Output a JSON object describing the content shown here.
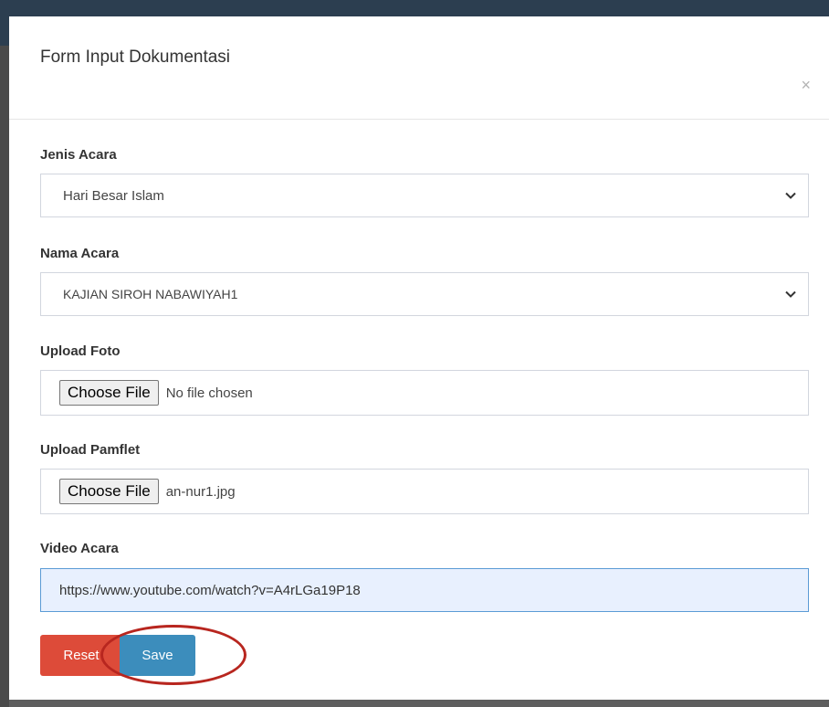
{
  "modal": {
    "title": "Form Input Dokumentasi",
    "close_label": "×"
  },
  "form": {
    "jenis_acara": {
      "label": "Jenis Acara",
      "value": "Hari Besar Islam"
    },
    "nama_acara": {
      "label": "Nama Acara",
      "value": "KAJIAN SIROH NABAWIYAH1"
    },
    "upload_foto": {
      "label": "Upload Foto",
      "button_label": "Choose File",
      "file_status": "No file chosen"
    },
    "upload_pamflet": {
      "label": "Upload Pamflet",
      "button_label": "Choose File",
      "file_status": "an-nur1.jpg"
    },
    "video_acara": {
      "label": "Video Acara",
      "value": "https://www.youtube.com/watch?v=A4rLGa19P18"
    }
  },
  "actions": {
    "reset_label": "Reset",
    "save_label": "Save"
  },
  "colors": {
    "reset_button": "#dd4b39",
    "save_button": "#3c8dbc",
    "highlight_ring": "#b8261f",
    "video_field_bg": "#e8f0fe"
  },
  "icons": {
    "select_arrow": "chevron-down-icon",
    "close": "close-icon"
  }
}
